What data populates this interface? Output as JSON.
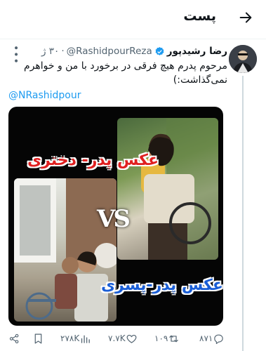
{
  "header": {
    "title": "پست"
  },
  "tweet": {
    "author_name": "رضا رشیدپور",
    "handle": "@RashidpourReza",
    "time": "۳۰ ژ",
    "text": "مرحوم پدرم هیچ فرقی در برخورد با من و خواهرم نمی‌گذاشت:)",
    "mention": "@NRashidpour",
    "media": {
      "caption_top": "عکس پدر- دختری",
      "vs": "VS",
      "caption_bottom": "عکس پدر-پسری"
    }
  },
  "actions": {
    "views": "۲۷۸K",
    "likes": "۷.۷K",
    "reposts": "۱۰۹",
    "replies": "۸۷۱"
  },
  "icons": [
    "back-arrow-icon",
    "verified-icon",
    "more-icon",
    "share-icon",
    "bookmark-icon",
    "views-icon",
    "like-icon",
    "repost-icon",
    "reply-icon"
  ],
  "colors": {
    "link": "#1d9bf0",
    "muted": "#536471",
    "caption_top": "#e02020",
    "caption_bottom": "#1a5ed6"
  }
}
